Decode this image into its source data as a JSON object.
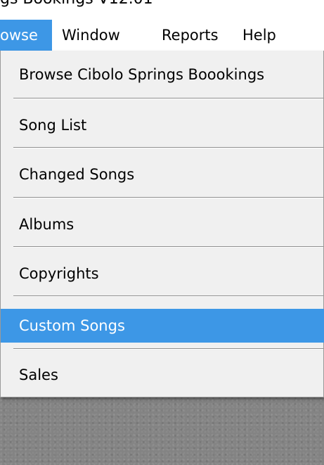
{
  "window": {
    "title": "gs Bookings V12.01"
  },
  "menubar": {
    "items": [
      {
        "label": "owse"
      },
      {
        "label": "Window"
      },
      {
        "label": "Reports"
      },
      {
        "label": "Help"
      }
    ]
  },
  "dropdown": {
    "items": [
      {
        "label": "Browse Cibolo Springs Boookings"
      },
      {
        "label": "Song List"
      },
      {
        "label": "Changed Songs"
      },
      {
        "label": "Albums"
      },
      {
        "label": "Copyrights"
      },
      {
        "label": "Custom Songs"
      },
      {
        "label": "Sales"
      }
    ],
    "highlighted_label": "Custom Songs"
  },
  "colors": {
    "highlight": "#3d97e6",
    "menu_background": "#f0f0f0",
    "desktop": "#838383"
  }
}
